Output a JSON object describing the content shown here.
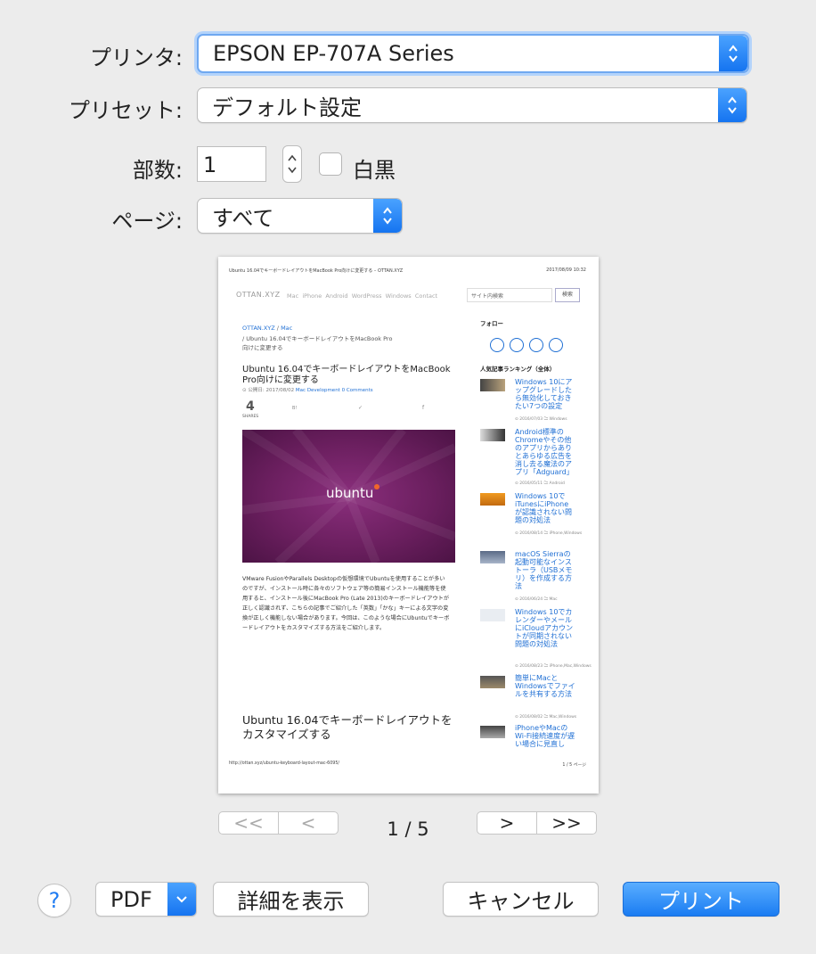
{
  "printer": {
    "label": "プリンタ:",
    "value": "EPSON EP-707A Series"
  },
  "preset": {
    "label": "プリセット:",
    "value": "デフォルト設定"
  },
  "copies": {
    "label": "部数:",
    "value": "1",
    "bw_label": "白黒",
    "bw_checked": false
  },
  "pages": {
    "label": "ページ:",
    "value": "すべて"
  },
  "preview": {
    "header_left": "Ubuntu 16.04でキーボードレイアウトをMacBook Pro向けに変更する – OTTAN.XYZ",
    "header_right": "2017/08/09 10:32",
    "site_name": "OTTAN.XYZ",
    "nav_items": [
      "Mac",
      "iPhone",
      "Android",
      "WordPress",
      "Windows",
      "Contact"
    ],
    "search_placeholder": "サイト内検索",
    "search_button": "検索",
    "breadcrumb_home": "OTTAN.XYZ",
    "breadcrumb_sep": "/",
    "breadcrumb_cat": "Mac",
    "breadcrumb_page_1": "/  Ubuntu 16.04でキーボードレイアウトをMacBook Pro",
    "breadcrumb_page_2": "向けに変更する",
    "title_1": "Ubuntu 16.04でキーボードレイアウトをMacBook",
    "title_2": "Pro向けに変更する",
    "published": "⊙ 公開日: 2017/08/02",
    "cat_mac": "Mac",
    "cat_dev": "Development",
    "comments": "0 Comments",
    "share_count": "4",
    "share_label": "SHARES",
    "share_icons": [
      "B!",
      "✓",
      "f"
    ],
    "hero_word": "ubuntu",
    "body_lines": [
      "VMware FusionやParallels Desktopの仮想環境でUbuntuを使用することが多い",
      "のですが、インストール時に各々のソフトウェア等の簡易インストール機能等を使",
      "用すると、インストール後にMacBook Pro (Late 2013)のキーボードレイアウトが",
      "正しく認識されず、こちらの記事でご紹介した「英数」「かな」キーによる文字の変",
      "換が正しく機能しない場合があります。今回は、このような場合にUbuntuでキーボ",
      "ードレイアウトをカスタマイズする方法をご紹介します。"
    ],
    "section_title_1": "Ubuntu 16.04でキーボードレイアウトを",
    "section_title_2": "カスタマイズする",
    "follow_label": "フォロー",
    "ranking_label": "人気記事ランキング（全体）",
    "ranking": [
      {
        "title": "Windows 10にアップグレードしたら無効化しておきたい7つの設定",
        "meta": "⊙ 2016/07/03  🗀 Windows"
      },
      {
        "title": "Android標準のChromeやその他のアプリからありとあらゆる広告を消し去る魔法のアプリ「Adguard」",
        "meta": "⊙ 2016/05/11  🗀 Android"
      },
      {
        "title": "Windows 10でiTunesにiPhoneが認識されない問題の対処法",
        "meta": "⊙ 2016/08/14  🗀 iPhone,Windows"
      },
      {
        "title": "macOS Sierraの起動可能なインストーラ（USBメモリ）を作成する方法",
        "meta": "⊙ 2016/06/24  🗀 Mac"
      },
      {
        "title": "Windows 10でカレンダーやメールにiCloudアカウントが同期されない問題の対処法",
        "meta": "⊙ 2016/08/23  🗀 iPhone,Mac,Windows"
      },
      {
        "title": "簡単にMacとWindowsでファイルを共有する方法",
        "meta": "⊙ 2016/08/02  🗀 Mac,Windows"
      },
      {
        "title": "iPhoneやMacのWi-Fi接続速度が遅い場合に見直し",
        "meta": ""
      }
    ],
    "footer_url": "http://ottan.xyz/ubuntu-keyboard-layout-mac-6095/",
    "footer_page": "1 / 5 ページ"
  },
  "pager": {
    "first": "<<",
    "prev": "<",
    "next": ">",
    "last": ">>",
    "indicator": "1 / 5"
  },
  "footer": {
    "help": "?",
    "pdf": "PDF",
    "details": "詳細を表示",
    "cancel": "キャンセル",
    "print": "プリント"
  },
  "colors": {
    "accent": "#1a7cf2",
    "ubuntu_purple": "#6b1f5f"
  }
}
